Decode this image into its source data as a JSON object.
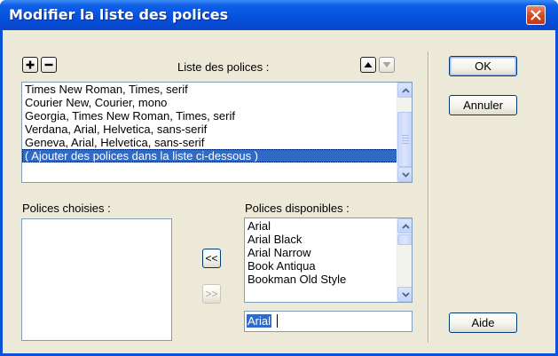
{
  "window": {
    "title": "Modifier la liste des polices"
  },
  "font_list": {
    "label": "Liste des polices :",
    "items": [
      "Times New Roman, Times, serif",
      "Courier New, Courier, mono",
      "Georgia, Times New Roman, Times, serif",
      "Verdana, Arial, Helvetica, sans-serif",
      "Geneva, Arial, Helvetica, sans-serif",
      "( Ajouter des polices dans la liste ci-dessous )"
    ],
    "selected_index": 5
  },
  "chosen_fonts": {
    "label": "Polices choisies :",
    "items": []
  },
  "available_fonts": {
    "label": "Polices disponibles :",
    "items": [
      "Arial",
      "Arial Black",
      "Arial Narrow",
      "Book Antiqua",
      "Bookman Old Style"
    ],
    "input_value": "Arial"
  },
  "buttons": {
    "add_label": "<<",
    "remove_label": ">>",
    "ok_label": "OK",
    "cancel_label": "Annuler",
    "help_label": "Aide"
  },
  "icons": {
    "add": "plus-icon",
    "remove": "minus-icon",
    "move_up": "triangle-up-icon",
    "move_down": "triangle-down-icon",
    "close": "close-icon"
  },
  "colors": {
    "titlebar": "#0650dc",
    "dialog_bg": "#ece9d8",
    "selection": "#316ac5",
    "close_button": "#d2471f"
  }
}
